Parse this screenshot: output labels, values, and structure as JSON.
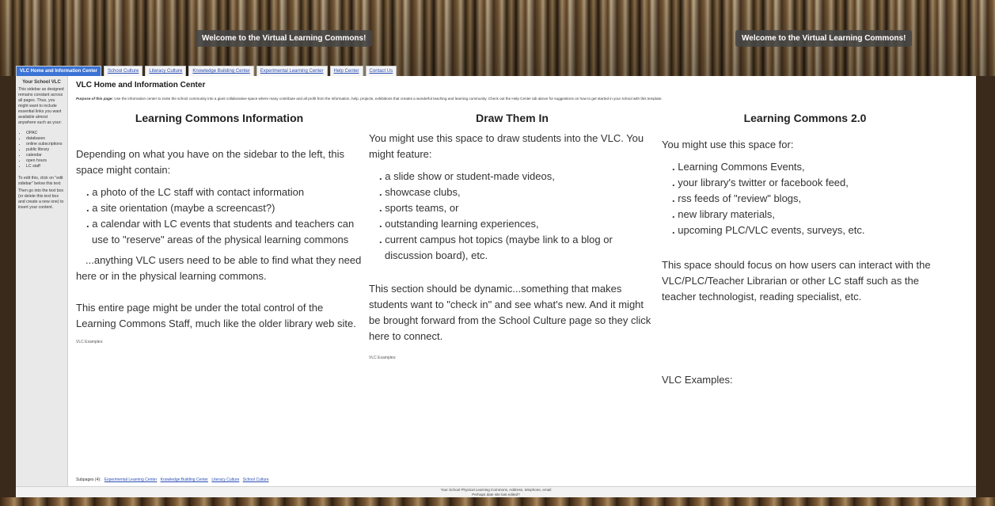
{
  "banner": {
    "welcome_left": "Welcome to the Virtual Learning Commons!",
    "welcome_right": "Welcome to the Virtual Learning Commons!"
  },
  "tabs": [
    {
      "label": "VLC Home and Information Center",
      "active": true
    },
    {
      "label": "School Culture"
    },
    {
      "label": "Literacy Culture"
    },
    {
      "label": "Knowledge Building Center"
    },
    {
      "label": "Experimental Learning Center"
    },
    {
      "label": "Help Center"
    },
    {
      "label": "Contact Us"
    }
  ],
  "sidebar": {
    "title": "Your School VLC",
    "intro": "This sidebar as designed remains constant across all pages. Thus, you might want to include essential links you want available almost anywhere such as your:",
    "items": [
      "OPAC",
      "databases",
      "online subscriptions",
      "public library",
      "calendar",
      "open hours",
      "LC staff"
    ],
    "outro1": "To edit this, click on \"edit sidebar\" below this text.",
    "outro2": "Then go into the text box (or delete this text box and create a new one) to insert your content."
  },
  "main": {
    "title": "VLC Home and Information Center",
    "purpose_label": "Purpose of this page:",
    "purpose_text": " Use the information center to invite the school community into a giant collaborative space where many contribute and all profit from the information, help, projects, exhibitions that creates a wonderful teaching and learning community. Check out the Help Center tab above for suggestions on how to get started in your school with this template."
  },
  "col1": {
    "heading": "Learning Commons Information",
    "p1": "Depending on what you have on the sidebar to the left, this space might contain:",
    "items": [
      "a photo of the LC staff with contact information",
      "a site orientation (maybe a screencast?)",
      "a calendar with LC events that students and teachers can use to \"reserve\" areas of the physical learning commons"
    ],
    "p2": "...anything VLC users need to be able to find what they need here or in the physical learning commons.",
    "p3": "This entire page might be under the total control of the Learning Commons Staff, much like the older library web site.",
    "examples": "VLC Examples:"
  },
  "col2": {
    "heading": "Draw Them In",
    "p1": "You might use this space to draw students into the VLC.  You might feature:",
    "items": [
      "a slide show or student-made videos,",
      "showcase clubs,",
      "sports teams, or",
      "outstanding learning experiences,",
      "current campus hot topics (maybe link to a blog or discussion board), etc."
    ],
    "p2": "This section should be dynamic...something that makes students want to \"check in\" and see what's new. And it might be brought forward from the School Culture page so they click here to connect.",
    "examples": "VLC Examples:"
  },
  "col3": {
    "heading": "Learning Commons 2.0",
    "p1": "You might use this space for:",
    "items": [
      "Learning Commons Events,",
      "your library's twitter or facebook feed,",
      "rss feeds of \"review\" blogs,",
      "new library materials,",
      "upcoming PLC/VLC events, surveys, etc."
    ],
    "p2": "This space should focus on how users can interact with the VLC/PLC/Teacher Librarian or other LC staff such as the teacher technologist, reading specialist, etc.",
    "examples": "VLC Examples:"
  },
  "subpages": {
    "label": "Subpages (4):",
    "links": [
      "Experimental Learning Center",
      "Knowledge Building Center",
      "Literacy Culture",
      "School Culture"
    ]
  },
  "footer": {
    "line1": "Your School Physical Learning Commons, Address, telephone, email",
    "line2": "Perhaps date site last edited?"
  }
}
